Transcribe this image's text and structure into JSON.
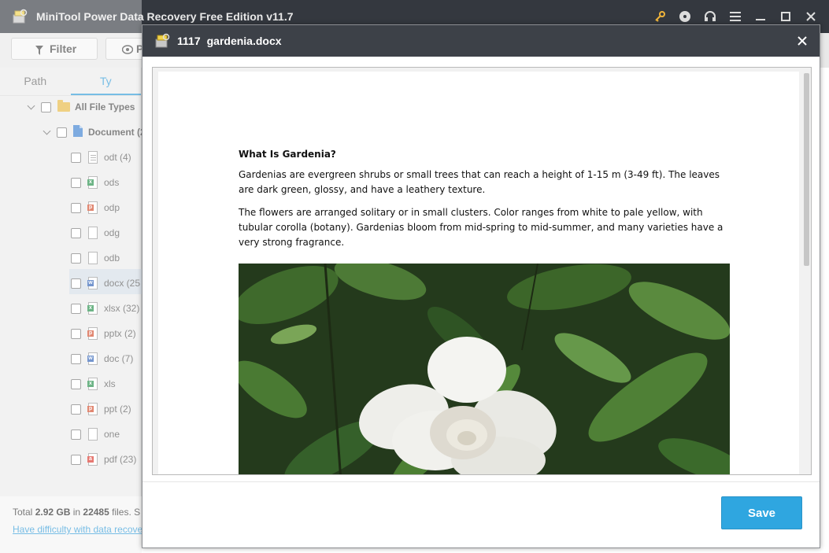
{
  "app": {
    "title": "MiniTool Power Data Recovery Free Edition v11.7",
    "icons": [
      "key-icon",
      "disc-icon",
      "headset-icon",
      "menu-icon",
      "minimize-icon",
      "maximize-icon",
      "close-icon"
    ]
  },
  "toolbar": {
    "filter_label": "Filter",
    "preview_label": "P"
  },
  "sidebar": {
    "tabs": [
      {
        "label": "Path",
        "active": false
      },
      {
        "label": "Ty",
        "active": true
      }
    ],
    "tree": [
      {
        "label": "All File Types",
        "bold": true,
        "icon": "folder-icon"
      },
      {
        "label": "Document (2",
        "bold": true,
        "icon": "document-icon"
      },
      {
        "label": "odt (4)",
        "icon": "odt-file-icon"
      },
      {
        "label": "ods",
        "icon": "ods-file-icon"
      },
      {
        "label": "odp",
        "icon": "odp-file-icon"
      },
      {
        "label": "odg",
        "icon": "odg-file-icon"
      },
      {
        "label": "odb",
        "icon": "odb-file-icon"
      },
      {
        "label": "docx (25",
        "icon": "docx-file-icon",
        "selected": true
      },
      {
        "label": "xlsx (32)",
        "icon": "xlsx-file-icon"
      },
      {
        "label": "pptx (2)",
        "icon": "pptx-file-icon"
      },
      {
        "label": "doc (7)",
        "icon": "doc-file-icon"
      },
      {
        "label": "xls",
        "icon": "xls-file-icon"
      },
      {
        "label": "ppt (2)",
        "icon": "ppt-file-icon"
      },
      {
        "label": "one",
        "icon": "one-file-icon"
      },
      {
        "label": "pdf (23)",
        "icon": "pdf-file-icon"
      }
    ]
  },
  "status": {
    "total_prefix": "Total ",
    "total_size": "2.92 GB",
    "total_mid": " in ",
    "total_files": "22485",
    "total_suffix": " files.  S",
    "help_link": "Have difficulty with data recove"
  },
  "preview": {
    "file_number": "1117",
    "file_name": "gardenia.docx",
    "save_label": "Save",
    "document": {
      "title": "What Is Gardenia?",
      "paragraphs": [
        "Gardenias are evergreen shrubs or small trees that can reach a height of 1-15 m (3-49 ft). The leaves are dark green, glossy, and have a leathery texture.",
        "The flowers are arranged solitary or in small clusters. Color ranges from white to pale yellow, with tubular corolla (botany). Gardenias bloom from mid-spring to mid-summer, and many varieties have a very strong fragrance."
      ]
    }
  },
  "colors": {
    "titlebar": "#34383f",
    "dialog_header": "#3d4148",
    "accent": "#2f9ad8",
    "save_button": "#2fa6e0"
  }
}
